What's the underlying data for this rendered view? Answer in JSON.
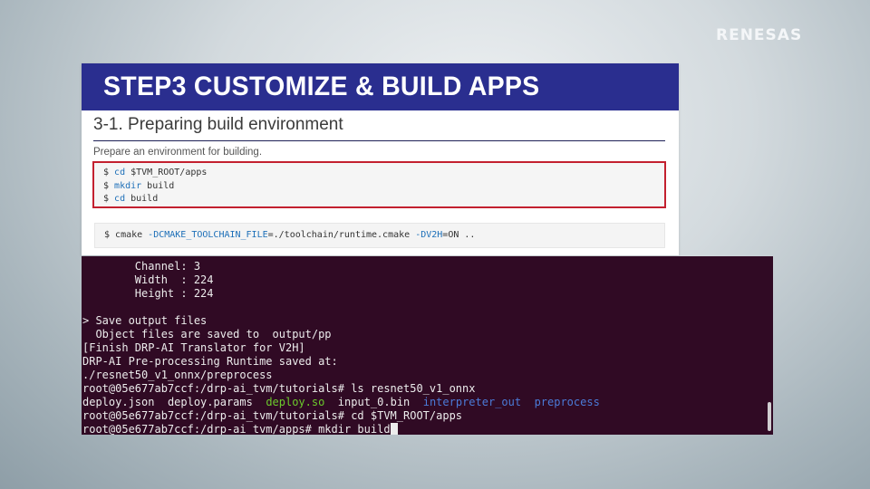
{
  "logo": {
    "text": "RENESAS"
  },
  "slide": {
    "banner_title": "STEP3  CUSTOMIZE & BUILD APPS",
    "section_title": "3-1. Preparing build environment",
    "description": "Prepare an environment for building.",
    "code_lines": [
      {
        "prompt": "$ ",
        "cmd": "cd",
        "rest": " $TVM_ROOT/apps"
      },
      {
        "prompt": "$ ",
        "cmd": "mkdir",
        "rest": " build"
      },
      {
        "prompt": "$ ",
        "cmd": "cd",
        "rest": " build"
      }
    ],
    "cmake": {
      "prompt": "$ ",
      "cmd": "cmake ",
      "flag1": "-DCMAKE_TOOLCHAIN_FILE",
      "mid": "=./toolchain/runtime.cmake ",
      "flag2": "-DV2H",
      "end": "=ON .."
    }
  },
  "terminal": {
    "lines": [
      "        Channel: 3",
      "        Width  : 224",
      "        Height : 224",
      "",
      "> Save output files",
      "  Object files are saved to  output/pp",
      "[Finish DRP-AI Translator for V2H]",
      "DRP-AI Pre-processing Runtime saved at:",
      "./resnet50_v1_onnx/preprocess",
      "root@05e677ab7ccf:/drp-ai_tvm/tutorials# ls resnet50_v1_onnx"
    ],
    "ls_output": {
      "f1": "deploy.json",
      "f2": "deploy.params",
      "f3": "deploy.so",
      "f4": "input_0.bin",
      "d1": "interpreter_out",
      "d2": "preprocess"
    },
    "line_cd": "root@05e677ab7ccf:/drp-ai_tvm/tutorials# cd $TVM_ROOT/apps",
    "line_current": "root@05e677ab7ccf:/drp-ai_tvm/apps# mkdir build"
  }
}
